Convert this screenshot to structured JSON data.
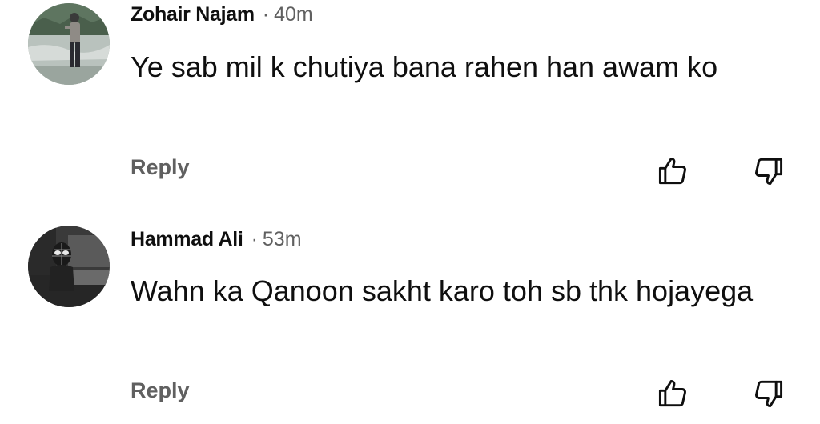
{
  "comments": [
    {
      "author": "Zohair Najam",
      "separator": "·",
      "time": "40m",
      "text": "Ye sab mil k chutiya bana rahen han awam ko",
      "reply_label": "Reply"
    },
    {
      "author": "Hammad Ali",
      "separator": "·",
      "time": "53m",
      "text": "Wahn ka Qanoon sakht karo toh sb thk hojayega",
      "reply_label": "Reply"
    }
  ],
  "icons": {
    "like": "thumbs-up-icon",
    "dislike": "thumbs-down-icon"
  },
  "colors": {
    "text": "#0f0f0f",
    "secondary": "#606060",
    "background": "#ffffff"
  }
}
